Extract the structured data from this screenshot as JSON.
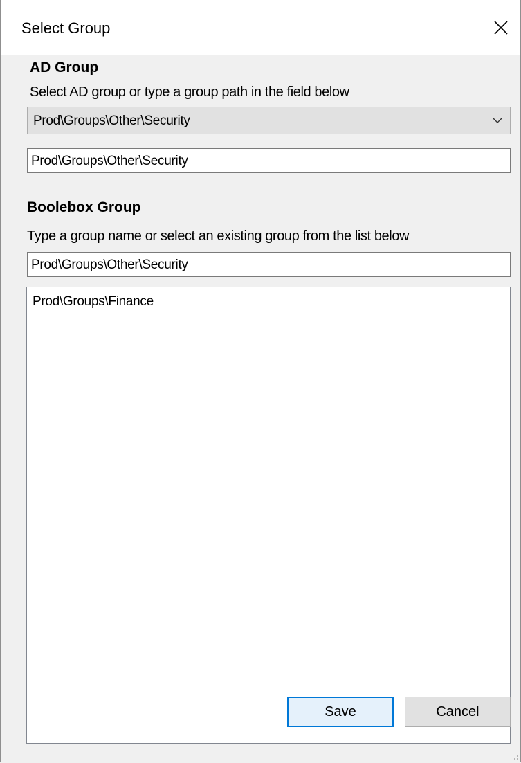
{
  "window": {
    "title": "Select Group"
  },
  "ad_group": {
    "heading": "AD Group",
    "hint": "Select AD group or type a group path in the field below",
    "dropdown_selected": "Prod\\Groups\\Other\\Security",
    "path_input_value": "Prod\\Groups\\Other\\Security"
  },
  "boolebox_group": {
    "heading": "Boolebox Group",
    "hint": "Type a group name or select an existing group from the list below",
    "name_input_value": "Prod\\Groups\\Other\\Security",
    "list_items": [
      "Prod\\Groups\\Finance"
    ]
  },
  "buttons": {
    "save_label": "Save",
    "cancel_label": "Cancel"
  },
  "icons": {
    "close": "close-icon",
    "dropdown": "chevron-down-icon",
    "resize": "resize-grip-icon"
  },
  "colors": {
    "accent": "#0078d7",
    "window_bg": "#f0f0f0",
    "title_bg": "#ffffff"
  }
}
